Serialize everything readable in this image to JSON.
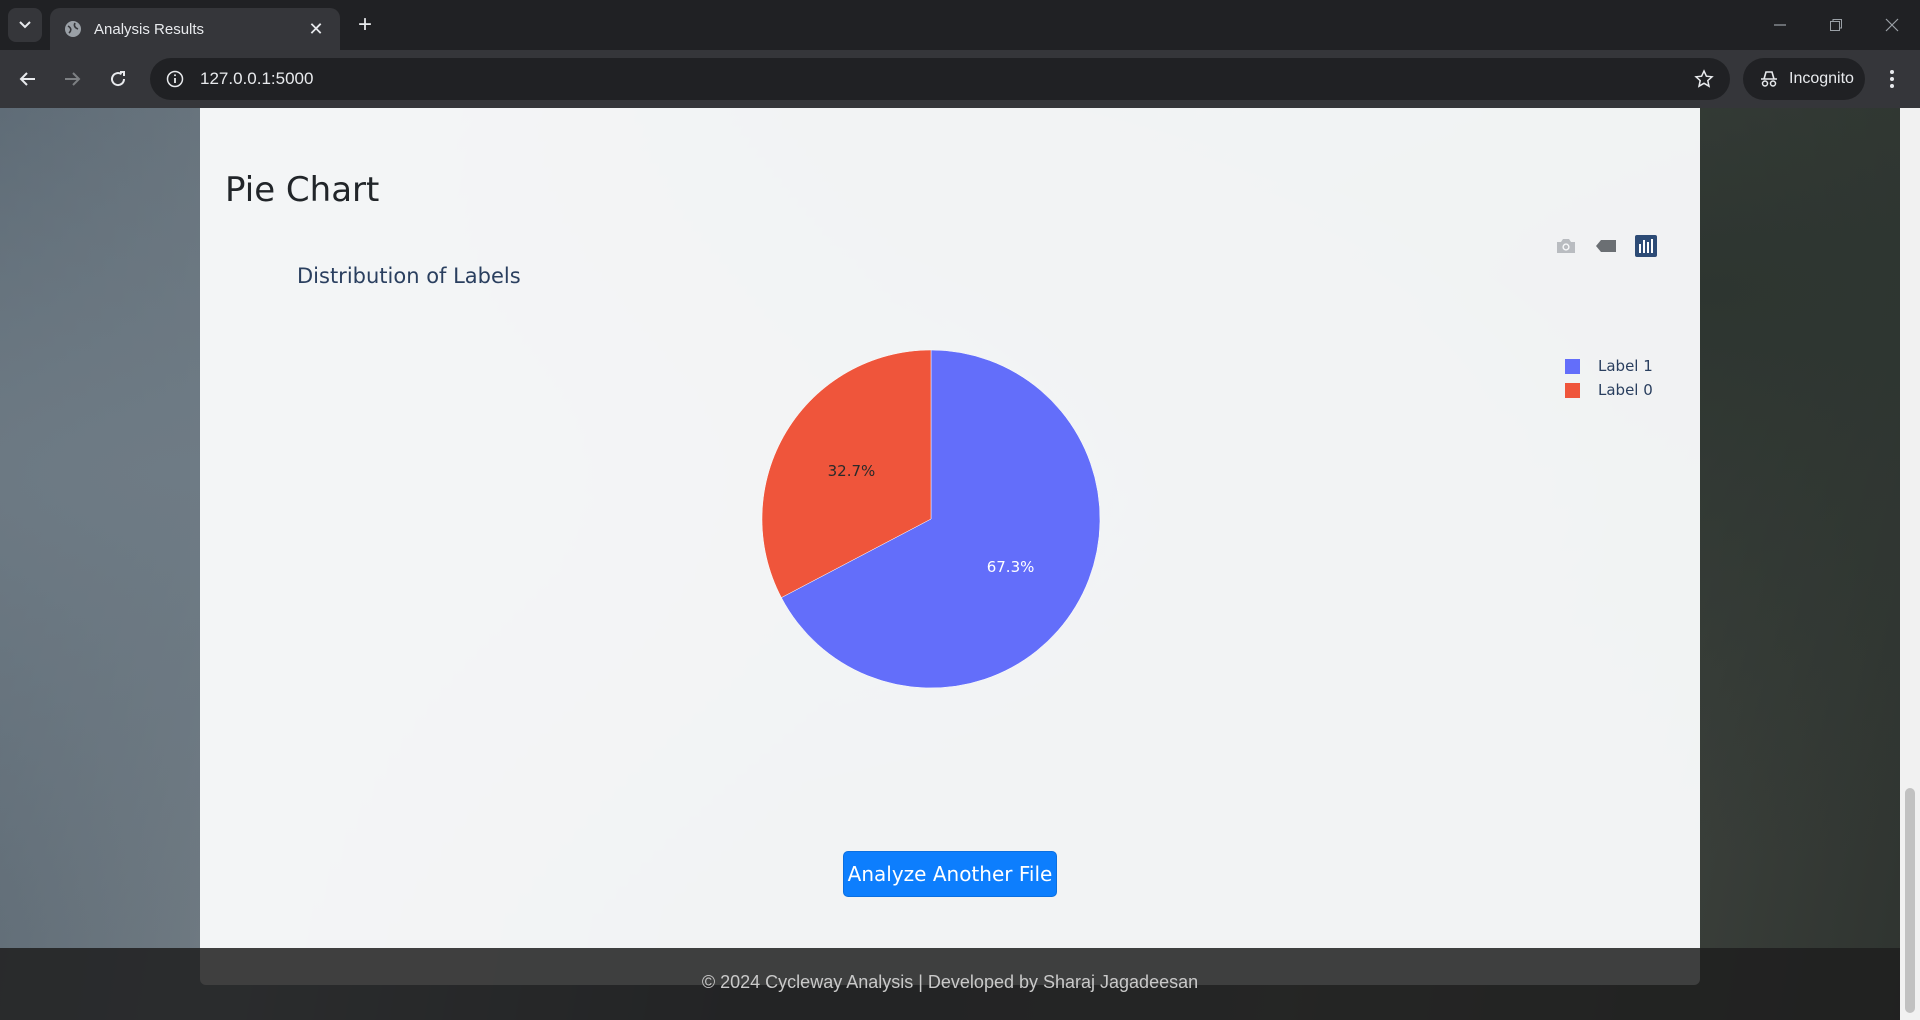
{
  "browser": {
    "tab_title": "Analysis Results",
    "url": "127.0.0.1:5000",
    "incognito_label": "Incognito"
  },
  "page": {
    "section_title": "Pie Chart",
    "action_button": "Analyze Another File",
    "footer": "© 2024 Cycleway Analysis | Developed by Sharaj Jagadeesan"
  },
  "chart_data": {
    "type": "pie",
    "title": "Distribution of Labels",
    "labels": [
      "Label 1",
      "Label 0"
    ],
    "values": [
      67.3,
      32.7
    ],
    "text_labels": [
      "67.3%",
      "32.7%"
    ],
    "colors": [
      "#636efa",
      "#ef553b"
    ],
    "legend_position": "top-right"
  },
  "icons": {
    "modebar": [
      "camera-icon",
      "tag-icon",
      "plotly-logo-icon"
    ]
  }
}
